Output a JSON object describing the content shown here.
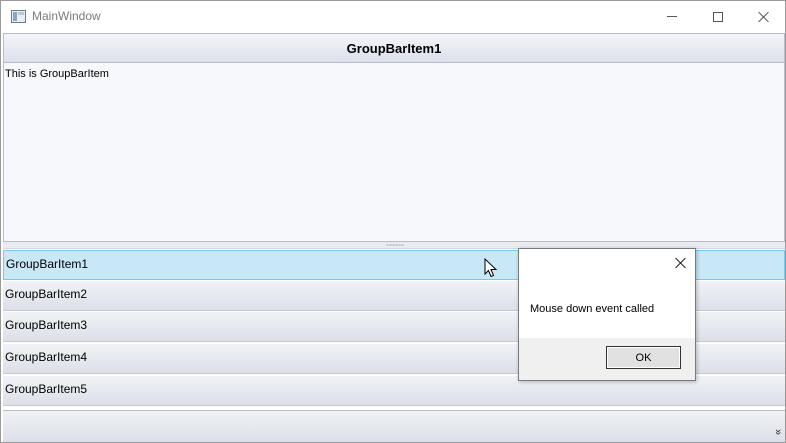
{
  "window": {
    "title": "MainWindow"
  },
  "groupbar": {
    "header": "GroupBarItem1",
    "content_text": "This is GroupBarItem",
    "items": [
      {
        "label": "GroupBarItem1",
        "selected": true
      },
      {
        "label": "GroupBarItem2",
        "selected": false
      },
      {
        "label": "GroupBarItem3",
        "selected": false
      },
      {
        "label": "GroupBarItem4",
        "selected": false
      },
      {
        "label": "GroupBarItem5",
        "selected": false
      }
    ],
    "overflow_icon": "chevron-double-down-icon"
  },
  "message_box": {
    "text": "Mouse down event called",
    "ok_label": "OK"
  },
  "colors": {
    "selected_item_bg": "#c9e8f7",
    "selected_item_border": "#7ec6ea",
    "header_gradient_top": "#f4f5f9",
    "header_gradient_bottom": "#dde0ea"
  }
}
